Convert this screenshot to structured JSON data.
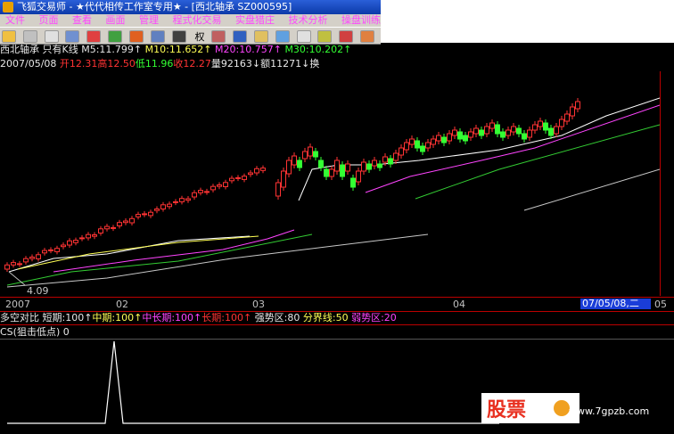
{
  "window": {
    "title": "飞狐交易师 - ★代代相传工作室专用★ - [西北轴承 SZ000595]"
  },
  "menu": {
    "items": [
      "文件",
      "页面",
      "查看",
      "画面",
      "管理",
      "程式化交易",
      "实盘猎庄",
      "技术分析",
      "操盘训练"
    ]
  },
  "toolbar": {
    "right_label": "权"
  },
  "stock_info": {
    "name": "西北轴承",
    "mode": "只有K线",
    "ma5": "M5:11.799↑",
    "ma10": "M10:11.652↑",
    "ma20": "M20:10.757↑",
    "ma30": "M30:10.202↑"
  },
  "quote": {
    "date": "2007/05/08",
    "open": "开12.31",
    "high": "高12.50",
    "low": "低11.96",
    "close": "收12.27",
    "vol": "量92163↓",
    "amount": "额11271↓",
    "extra": "换"
  },
  "chart_labels": {
    "low_value": "4.09"
  },
  "time_axis": {
    "labels": [
      "2007",
      "02",
      "03",
      "04"
    ],
    "cursor_date": "07/05/08,二",
    "right_tick": "05"
  },
  "indicator1": {
    "name": "多空对比",
    "short": "短期:100↑",
    "mid": "中期:100↑",
    "midlong": "中长期:100↑",
    "long": "长期:100↑",
    "strong": "强势区:80",
    "boundary": "分界线:50",
    "weak": "弱势区:20"
  },
  "indicator2": {
    "name": "CS(狙击低点)",
    "value": "0"
  },
  "watermark": {
    "text": "股票",
    "url": "www.7gpzb.com"
  },
  "colors": {
    "up": "#ff3333",
    "down": "#33ff33",
    "ma5": "#ffffff",
    "ma10": "#ffff55",
    "ma20": "#ff44ff",
    "ma30": "#33cc33",
    "ma_long": "#c8c8c8"
  }
}
